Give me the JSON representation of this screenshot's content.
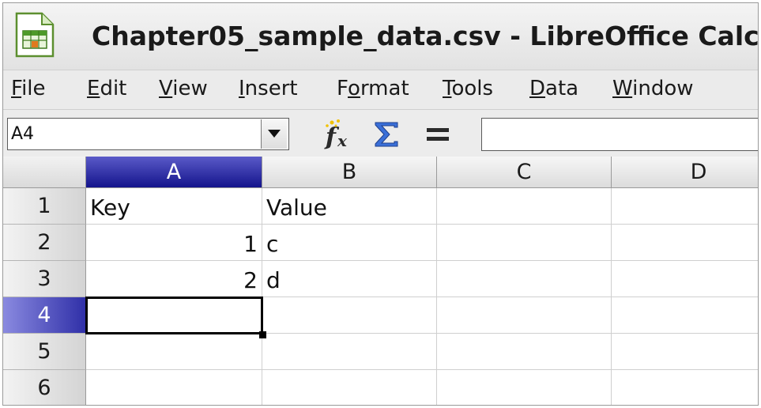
{
  "window": {
    "title": "Chapter05_sample_data.csv - LibreOffice Calc",
    "app_icon": "libreoffice-calc-icon"
  },
  "menu": [
    {
      "pre": "",
      "u": "F",
      "post": "ile"
    },
    {
      "pre": "",
      "u": "E",
      "post": "dit"
    },
    {
      "pre": "",
      "u": "V",
      "post": "iew"
    },
    {
      "pre": "",
      "u": "I",
      "post": "nsert"
    },
    {
      "pre": "F",
      "u": "o",
      "post": "rmat"
    },
    {
      "pre": "",
      "u": "T",
      "post": "ools"
    },
    {
      "pre": "",
      "u": "D",
      "post": "ata"
    },
    {
      "pre": "",
      "u": "W",
      "post": "indow"
    }
  ],
  "formula_bar": {
    "name_box": "A4",
    "input_value": "",
    "icons": [
      "function-wizard-icon",
      "sum-icon",
      "formula-icon"
    ]
  },
  "sheet": {
    "columns": [
      "A",
      "B",
      "C",
      "D"
    ],
    "selected_column": "A",
    "rows": [
      "1",
      "2",
      "3",
      "4",
      "5",
      "6"
    ],
    "selected_row": "4",
    "active_cell": "A4",
    "cells": [
      [
        "Key",
        "Value",
        "",
        ""
      ],
      [
        "1",
        "c",
        "",
        ""
      ],
      [
        "2",
        "d",
        "",
        ""
      ],
      [
        "",
        "",
        "",
        ""
      ],
      [
        "",
        "",
        "",
        ""
      ],
      [
        "",
        "",
        "",
        ""
      ]
    ]
  }
}
